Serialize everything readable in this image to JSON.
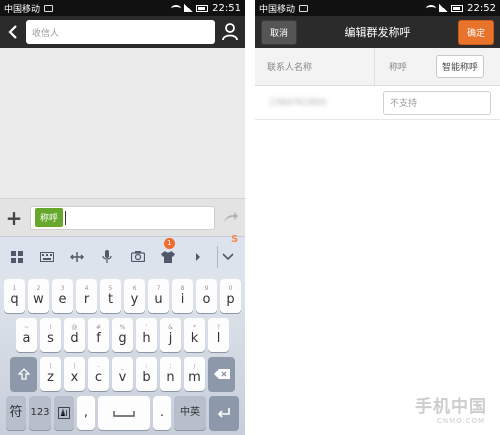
{
  "status_left": {
    "carrier": "中国移动",
    "time": "22:51"
  },
  "status_right": {
    "carrier": "中国移动",
    "time": "22:52"
  },
  "left": {
    "recipient_placeholder": "收信人",
    "message_tag": "称呼",
    "ime_icons": [
      "grid-icon",
      "keyboard-icon",
      "cursor-move-icon",
      "mic-icon",
      "camera-icon",
      "shirt-icon",
      "emoji-icon",
      "collapse-icon"
    ],
    "ime_badge": "1",
    "ime_logo": "S",
    "keyboard": {
      "row1": [
        "q",
        "w",
        "e",
        "r",
        "t",
        "y",
        "u",
        "i",
        "o",
        "p"
      ],
      "row1_sub": [
        "1",
        "2",
        "3",
        "4",
        "5",
        "6",
        "7",
        "8",
        "9",
        "0"
      ],
      "row2": [
        "a",
        "s",
        "d",
        "f",
        "g",
        "h",
        "j",
        "k",
        "l"
      ],
      "row2_sub": [
        "~",
        "!",
        "@",
        "#",
        "%",
        "'",
        "&",
        "*",
        "?"
      ],
      "row3": [
        "z",
        "x",
        "c",
        "v",
        "b",
        "n",
        "m"
      ],
      "row3_sub": [
        "(",
        ")",
        "-",
        "_",
        ":",
        ";",
        "/"
      ],
      "symbol_key": "符",
      "num_key": "123",
      "comma_key": ",",
      "period_key": ".",
      "lang_key": "中英"
    }
  },
  "right": {
    "cancel": "取消",
    "title": "编辑群发称呼",
    "confirm": "确定",
    "col_name": "联系人名称",
    "col_title": "称呼",
    "smart_button": "智能称呼",
    "row_name": "1384761800",
    "row_placeholder": "不支持"
  },
  "watermark": {
    "main": "手机中国",
    "sub": "CNMO.COM"
  },
  "colors": {
    "accent": "#e8732b",
    "tag_green": "#67a82c",
    "topbar": "#2b2b2b"
  }
}
